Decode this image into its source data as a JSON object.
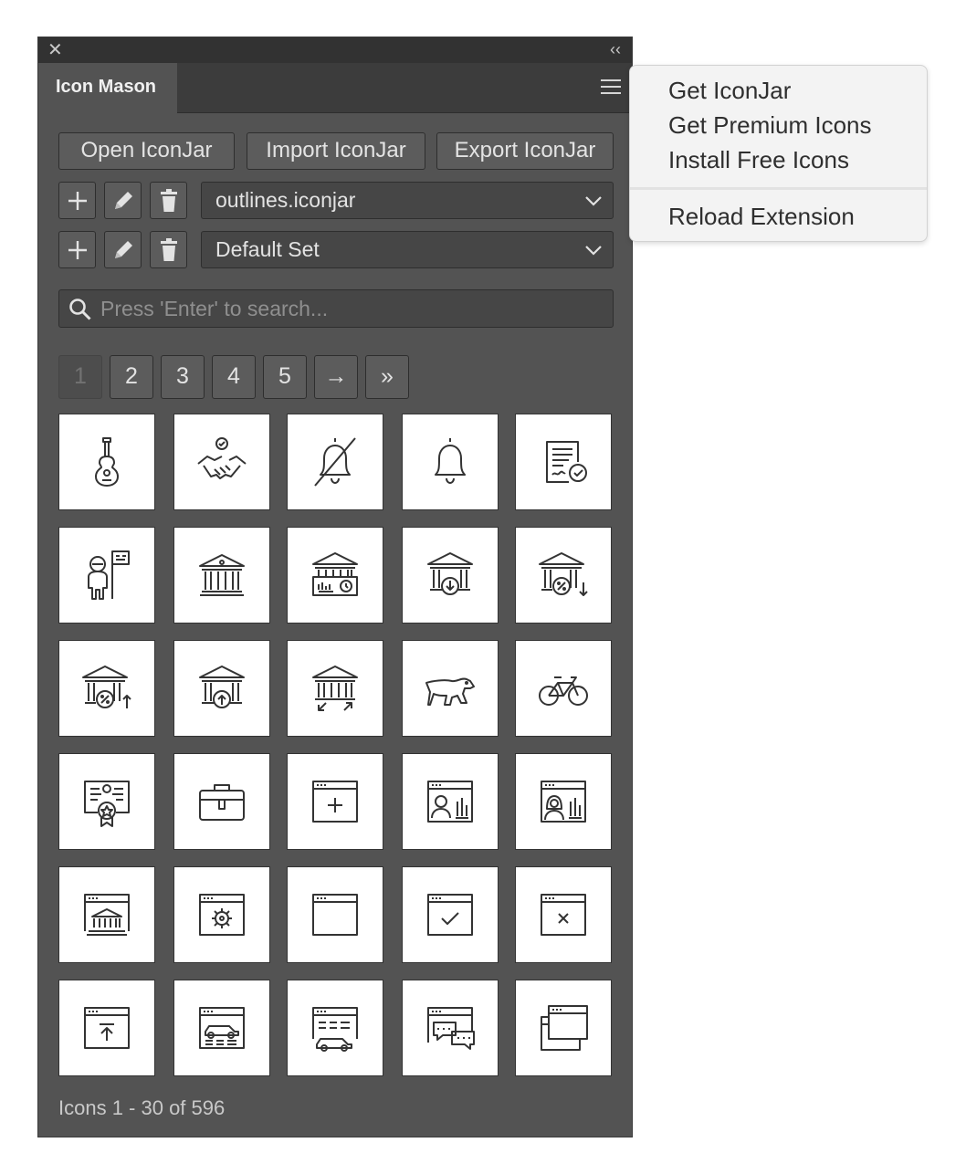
{
  "window": {
    "close_glyph": "✕",
    "collapse_glyph": "‹‹"
  },
  "tab": {
    "label": "Icon Mason"
  },
  "toolbar": {
    "open": "Open IconJar",
    "import": "Import IconJar",
    "export": "Export IconJar"
  },
  "jar_select": {
    "value": "outlines.iconjar"
  },
  "set_select": {
    "value": "Default Set"
  },
  "search": {
    "placeholder": "Press 'Enter' to search..."
  },
  "pagination": {
    "pages": [
      "1",
      "2",
      "3",
      "4",
      "5"
    ],
    "current": "1",
    "next": "→",
    "last": "»"
  },
  "icons": [
    "guitar-icon",
    "handshake-check-icon",
    "bell-off-icon",
    "bell-icon",
    "contract-approved-icon",
    "astronaut-flag-icon",
    "bank-icon",
    "bank-chart-clock-icon",
    "bank-download-icon",
    "bank-percent-down-icon",
    "bank-percent-up-icon",
    "bank-upload-icon",
    "bank-transfer-icon",
    "bear-icon",
    "bicycle-icon",
    "certificate-icon",
    "briefcase-icon",
    "browser-add-icon",
    "browser-user-chart-icon",
    "browser-female-chart-icon",
    "browser-bank-icon",
    "browser-settings-icon",
    "browser-window-icon",
    "browser-check-icon",
    "browser-close-icon",
    "browser-upload-icon",
    "browser-car-icon",
    "browser-car-list-icon",
    "browser-chat-icon",
    "browser-windows-icon"
  ],
  "footer": {
    "status": "Icons 1 - 30 of 596"
  },
  "menu": {
    "items": [
      "Get IconJar",
      "Get Premium Icons",
      "Install Free Icons"
    ],
    "reload": "Reload Extension"
  }
}
